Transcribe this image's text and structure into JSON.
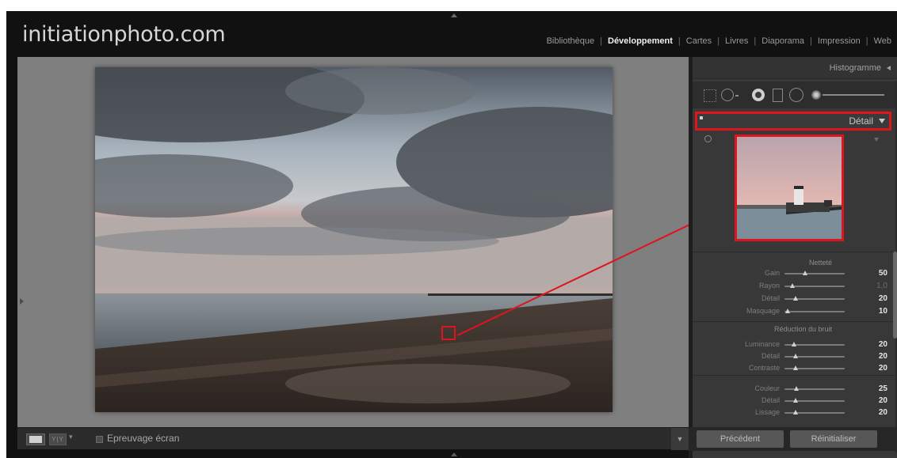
{
  "brand": "initiationphoto.com",
  "modules": [
    {
      "label": "Bibliothèque",
      "active": false
    },
    {
      "label": "Développement",
      "active": true
    },
    {
      "label": "Cartes",
      "active": false
    },
    {
      "label": "Livres",
      "active": false
    },
    {
      "label": "Diaporama",
      "active": false
    },
    {
      "label": "Impression",
      "active": false
    },
    {
      "label": "Web",
      "active": false
    }
  ],
  "module_separator": "|",
  "panel": {
    "histogram_label": "Histogramme",
    "detail_label": "Détail",
    "sharpening": {
      "title": "Netteté",
      "sliders": [
        {
          "label": "Gain",
          "value": "50",
          "fraction": 0.34,
          "dim": false
        },
        {
          "label": "Rayon",
          "value": "1,0",
          "fraction": 0.13,
          "dim": true
        },
        {
          "label": "Détail",
          "value": "20",
          "fraction": 0.18,
          "dim": false
        },
        {
          "label": "Masquage",
          "value": "10",
          "fraction": 0.05,
          "dim": false
        }
      ]
    },
    "noise_reduction": {
      "title": "Réduction du bruit",
      "sliders": [
        {
          "label": "Luminance",
          "value": "20",
          "fraction": 0.16,
          "dim": false
        },
        {
          "label": "Détail",
          "value": "20",
          "fraction": 0.18,
          "dim": false
        },
        {
          "label": "Contraste",
          "value": "20",
          "fraction": 0.18,
          "dim": false
        },
        {
          "label": "Couleur",
          "value": "25",
          "fraction": 0.2,
          "dim": false
        },
        {
          "label": "Détail",
          "value": "20",
          "fraction": 0.18,
          "dim": false
        },
        {
          "label": "Lissage",
          "value": "20",
          "fraction": 0.18,
          "dim": false
        }
      ]
    },
    "previous_label": "Précédent",
    "reset_label": "Réinitialiser"
  },
  "toolbar": {
    "softproof_label": "Epreuvage écran",
    "compare_glyph": "Y|Y",
    "dropdown_glyph": "▾",
    "menu_glyph": "▼"
  },
  "colors": {
    "highlight": "#e0141e",
    "active_module": "#f0f0f0",
    "panel_bg": "#383838"
  },
  "icons": [
    "crop-overlay-icon",
    "spot-removal-icon",
    "red-eye-icon",
    "graduated-filter-icon",
    "radial-filter-icon",
    "adjustment-brush-icon",
    "target-adjust-icon",
    "clipping-toggle-icon"
  ]
}
